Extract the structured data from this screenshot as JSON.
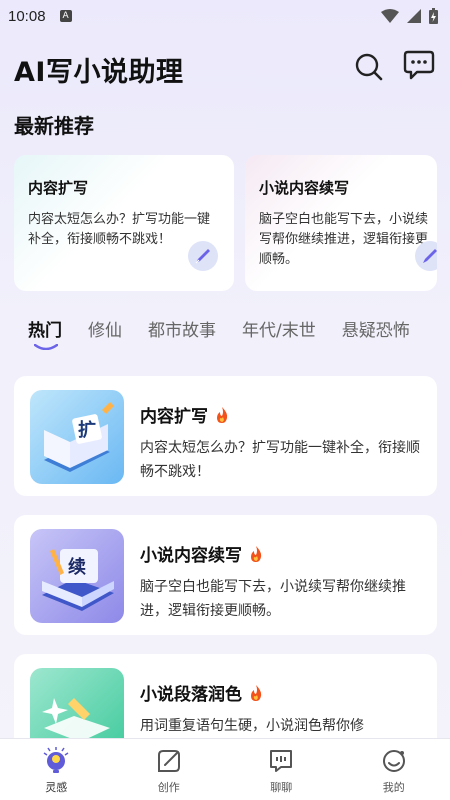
{
  "status": {
    "time": "10:08",
    "badge": "A"
  },
  "header": {
    "title": "AI写小说助理"
  },
  "section": {
    "title": "最新推荐"
  },
  "recommend": [
    {
      "title": "内容扩写",
      "desc": "内容太短怎么办？扩写功能一键补全，衔接顺畅不跳戏！"
    },
    {
      "title": "小说内容续写",
      "desc": "脑子空白也能写下去，小说续写帮你继续推进，逻辑衔接更顺畅。"
    }
  ],
  "tabs": [
    "热门",
    "修仙",
    "都市故事",
    "年代/末世",
    "悬疑恐怖"
  ],
  "thumb_labels": {
    "expand": "扩",
    "continue": "续"
  },
  "list": [
    {
      "title": "内容扩写",
      "desc": "内容太短怎么办？扩写功能一键补全，衔接顺畅不跳戏！"
    },
    {
      "title": "小说内容续写",
      "desc": "脑子空白也能写下去，小说续写帮你继续推进，逻辑衔接更顺畅。"
    },
    {
      "title": "小说段落润色",
      "desc": "用词重复语句生硬，小说润色帮你修"
    }
  ],
  "nav": [
    {
      "label": "灵感"
    },
    {
      "label": "创作"
    },
    {
      "label": "聊聊"
    },
    {
      "label": "我的"
    }
  ],
  "colors": {
    "accent": "#6b63e8",
    "fire": "#f2521b"
  }
}
